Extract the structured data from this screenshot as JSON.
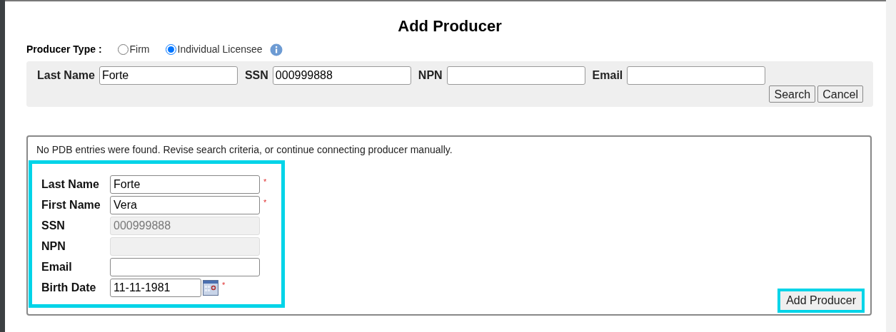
{
  "title": "Add Producer",
  "producer_type": {
    "label": "Producer Type :",
    "options": [
      {
        "label": "Firm",
        "selected": false
      },
      {
        "label": "Individual Licensee",
        "selected": true
      }
    ]
  },
  "search": {
    "fields": [
      {
        "label": "Last Name",
        "value": "Forte"
      },
      {
        "label": "SSN",
        "value": "000999888"
      },
      {
        "label": "NPN"
      },
      {
        "label": "Email"
      }
    ],
    "buttons": [
      "Search",
      "Cancel"
    ]
  },
  "result": {
    "message": "No PDB entries were found. Revise search criteria, or continue connecting producer manually.",
    "highlighted": true,
    "fields": [
      {
        "label": "Last Name",
        "value": "Forte",
        "kind": "text",
        "required_mark": "*"
      },
      {
        "label": "First Name",
        "value": "Vera",
        "kind": "text",
        "required_mark": "*"
      },
      {
        "label": "SSN",
        "value": "000999888",
        "kind": "disabled"
      },
      {
        "label": "NPN",
        "kind": "disabled"
      },
      {
        "label": "Email",
        "kind": "text"
      },
      {
        "label": "Birth Date",
        "value": "11-11-1981",
        "kind": "date",
        "required_mark": "*"
      }
    ],
    "button": {
      "label": "Add Producer",
      "highlighted": true
    }
  }
}
